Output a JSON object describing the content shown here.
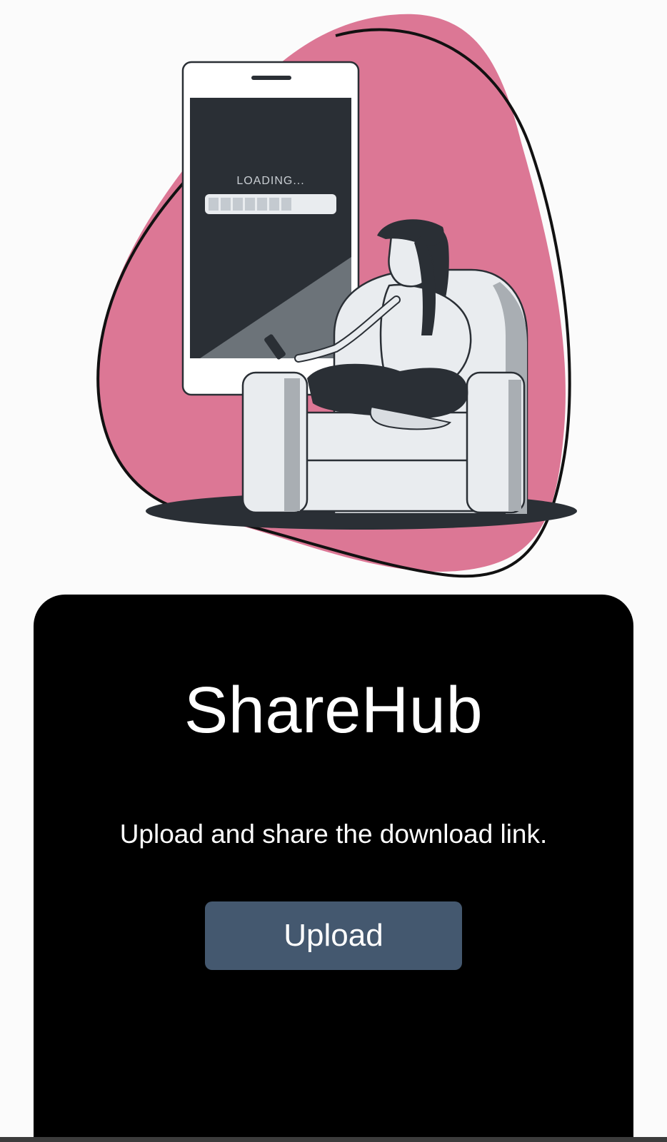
{
  "illustration": {
    "phone_screen_text": "LOADING...",
    "loading_progress": 0.65,
    "colors": {
      "blob": "#dc7795",
      "dark": "#2a2f35",
      "light": "#e9ecef"
    }
  },
  "card": {
    "title": "ShareHub",
    "tagline": "Upload and share the download link.",
    "upload_label": "Upload",
    "colors": {
      "background": "#000000",
      "button": "#44586f",
      "text": "#ffffff"
    }
  }
}
